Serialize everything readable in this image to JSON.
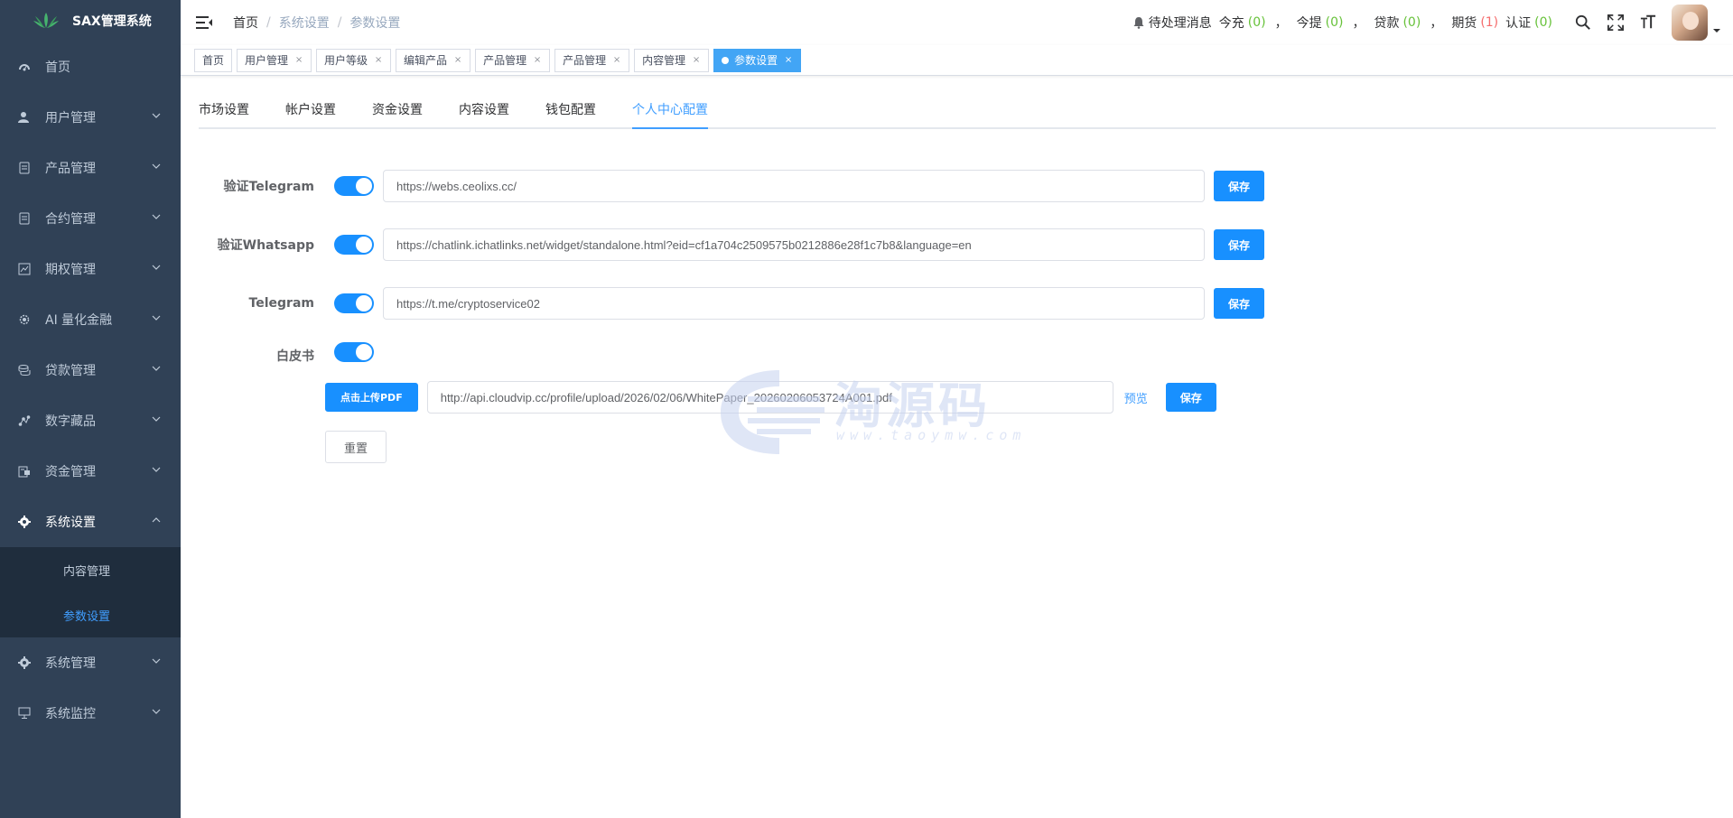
{
  "app": {
    "title": "SAX管理系统"
  },
  "sidebar": {
    "items": [
      {
        "label": "首页",
        "icon": "dashboard-icon"
      },
      {
        "label": "用户管理",
        "icon": "user-icon"
      },
      {
        "label": "产品管理",
        "icon": "document-icon"
      },
      {
        "label": "合约管理",
        "icon": "document-icon"
      },
      {
        "label": "期权管理",
        "icon": "chart-icon"
      },
      {
        "label": "AI 量化金融",
        "icon": "gear-icon"
      },
      {
        "label": "贷款管理",
        "icon": "coins-icon"
      },
      {
        "label": "数字藏品",
        "icon": "collection-icon"
      },
      {
        "label": "资金管理",
        "icon": "wallet-icon"
      },
      {
        "label": "系统设置",
        "icon": "settings-icon"
      },
      {
        "label": "系统管理",
        "icon": "settings-icon"
      },
      {
        "label": "系统监控",
        "icon": "monitor-icon"
      }
    ],
    "submenu": [
      {
        "label": "内容管理"
      },
      {
        "label": "参数设置"
      }
    ]
  },
  "breadcrumb": [
    "首页",
    "系统设置",
    "参数设置"
  ],
  "notice": {
    "title": "待处理消息",
    "items": [
      {
        "label": "今充",
        "count": "(0)"
      },
      {
        "label": "今提",
        "count": "(0)"
      },
      {
        "label": "贷款",
        "count": "(0)"
      },
      {
        "label": "期货",
        "count": "(1)"
      },
      {
        "label": "认证",
        "count": "(0)"
      }
    ],
    "separator": "，"
  },
  "tags": [
    {
      "label": "首页"
    },
    {
      "label": "用户管理"
    },
    {
      "label": "用户等级"
    },
    {
      "label": "编辑产品"
    },
    {
      "label": "产品管理"
    },
    {
      "label": "产品管理"
    },
    {
      "label": "内容管理"
    },
    {
      "label": "参数设置"
    }
  ],
  "tag_close": "×",
  "tabs": [
    "市场设置",
    "帐户设置",
    "资金设置",
    "内容设置",
    "钱包配置",
    "个人中心配置"
  ],
  "form": {
    "rows": [
      {
        "label": "验证Telegram",
        "value": "https://webs.ceolixs.cc/",
        "enabled": true
      },
      {
        "label": "验证Whatsapp",
        "value": "https://chatlink.ichatlinks.net/widget/standalone.html?eid=cf1a704c2509575b0212886e28f1c7b8&language=en",
        "enabled": true
      },
      {
        "label": "Telegram",
        "value": "https://t.me/cryptoservice02",
        "enabled": true
      }
    ],
    "whitepaper": {
      "label": "白皮书",
      "enabled": true,
      "upload_label": "点击上传PDF",
      "value": "http://api.cloudvip.cc/profile/upload/2026/02/06/WhitePaper_20260206053724A001.pdf",
      "preview_label": "预览"
    },
    "save_label": "保存",
    "reset_label": "重置"
  },
  "watermark": {
    "cn": "淘源码",
    "en": "www.taoymw.com"
  },
  "colors": {
    "sidebar_bg": "#304156",
    "primary": "#1890ff",
    "active_text": "#409eff",
    "green": "#67c23a",
    "red": "#f56c6c"
  }
}
